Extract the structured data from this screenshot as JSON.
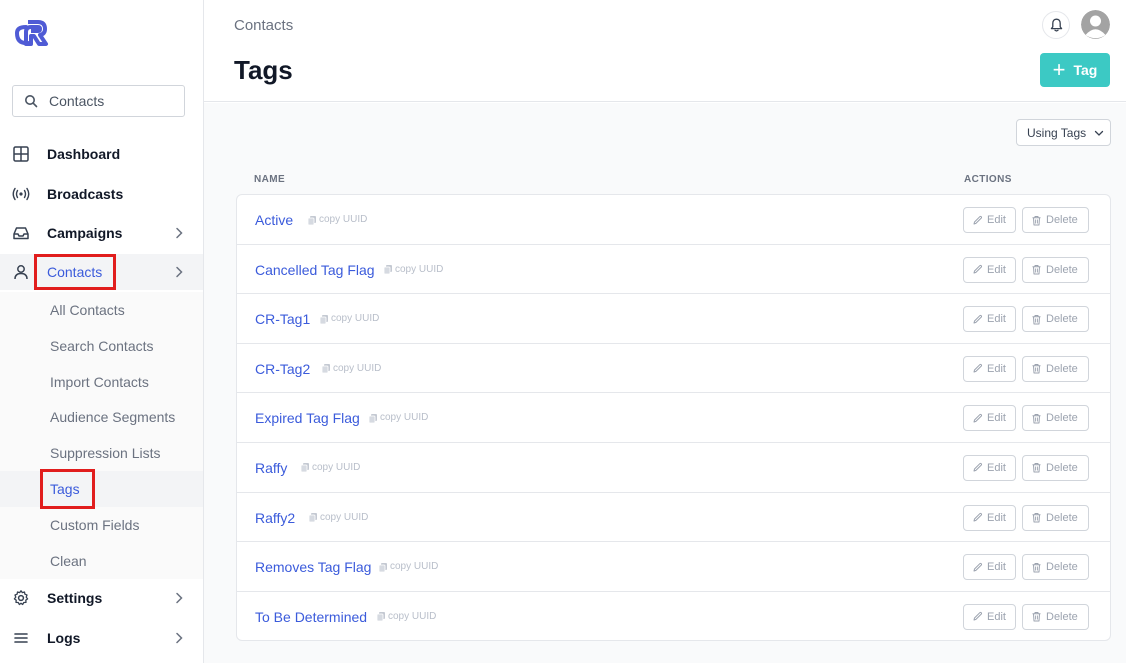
{
  "search": {
    "placeholder": "Contacts"
  },
  "sidebar": {
    "nav": [
      {
        "label": "Dashboard",
        "icon": "grid-icon"
      },
      {
        "label": "Broadcasts",
        "icon": "broadcast-icon"
      },
      {
        "label": "Campaigns",
        "icon": "inbox-icon"
      },
      {
        "label": "Contacts",
        "icon": "user-icon"
      },
      {
        "label": "Settings",
        "icon": "gear-icon"
      },
      {
        "label": "Logs",
        "icon": "menu-icon"
      }
    ],
    "contacts_sub": [
      {
        "label": "All Contacts"
      },
      {
        "label": "Search Contacts"
      },
      {
        "label": "Import Contacts"
      },
      {
        "label": "Audience Segments"
      },
      {
        "label": "Suppression Lists"
      },
      {
        "label": "Tags"
      },
      {
        "label": "Custom Fields"
      },
      {
        "label": "Clean"
      }
    ]
  },
  "header": {
    "breadcrumb": "Contacts",
    "title": "Tags",
    "add_button_label": "Tag"
  },
  "filter": {
    "label": "Using Tags"
  },
  "table": {
    "columns": {
      "name": "NAME",
      "actions": "ACTIONS"
    },
    "copy_label": "copy UUID",
    "edit_label": "Edit",
    "delete_label": "Delete",
    "rows": [
      {
        "name": "Active"
      },
      {
        "name": "Cancelled Tag Flag"
      },
      {
        "name": "CR-Tag1"
      },
      {
        "name": "CR-Tag2"
      },
      {
        "name": "Expired Tag Flag"
      },
      {
        "name": "Raffy"
      },
      {
        "name": "Raffy2"
      },
      {
        "name": "Removes Tag Flag"
      },
      {
        "name": "To Be Determined"
      }
    ]
  },
  "colors": {
    "accent": "#3b5bdb",
    "primary_button": "#3cc9c4",
    "highlight_box": "#e11d1d"
  }
}
